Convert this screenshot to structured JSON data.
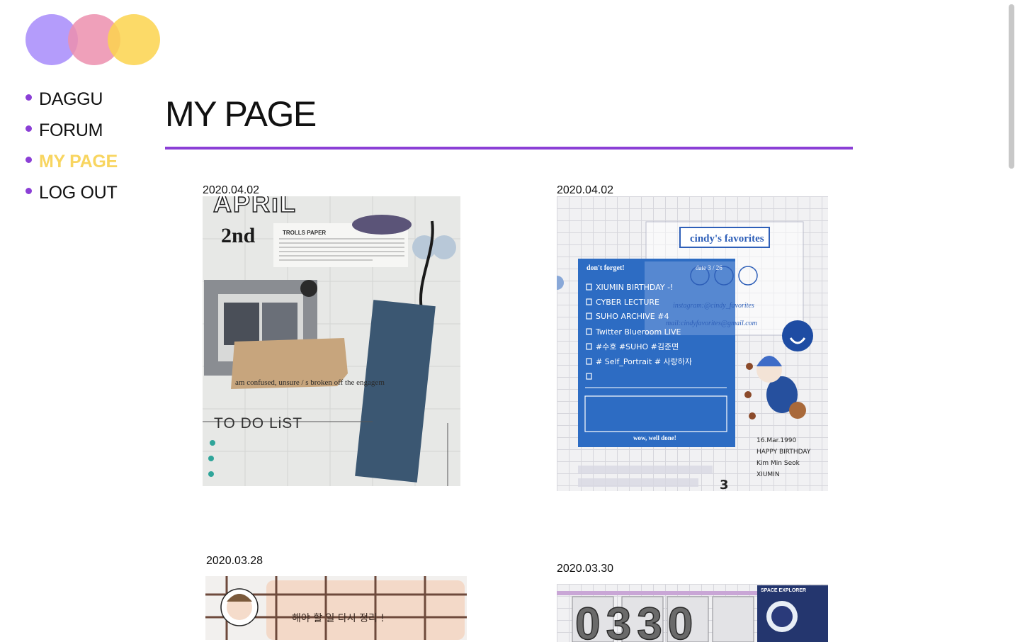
{
  "brand": {
    "logo_colors": [
      "#a78bfa",
      "#ec8fae",
      "#fcd34d"
    ]
  },
  "theme": {
    "accent": "#8b3fd6",
    "active_nav": "#f8d560",
    "rule": "#8b3fd6"
  },
  "nav": {
    "items": [
      {
        "label": "DAGGU"
      },
      {
        "label": "FORUM"
      },
      {
        "label": "MY PAGE"
      },
      {
        "label": "LOG OUT"
      }
    ]
  },
  "main": {
    "title": "MY PAGE",
    "posts": [
      {
        "date": "2020.04.02",
        "photo_text": {
          "month": "APRiL",
          "day": "2nd",
          "brand": "TROLLS PAPER",
          "todo": "TO DO LiST",
          "torn": "am confused, unsure / s broken off the engagem"
        }
      },
      {
        "date": "2020.04.02",
        "photo_text": {
          "banner": "cindy's favorites",
          "heading": "don't forget!",
          "date": "date 3 / 26",
          "tasks": [
            "XIUMIN BIRTHDAY -!",
            "CYBER LECTURE",
            "SUHO ARCHIVE #4",
            "Twitter Blueroom LIVE",
            "#수호 #SUHO #김준면",
            "# Self_Portrait # 사랑하자"
          ],
          "insta": "instagram:@cindy_favorites",
          "mail": "mail:cindyfavorites@gmail.com",
          "footer": "wow, well done!",
          "note": [
            "16.Mar.1990",
            "HAPPY BIRTHDAY",
            "Kim Min Seok",
            "XIUMIN"
          ],
          "number": "3"
        }
      },
      {
        "date": "2020.03.28",
        "photo_text": {
          "korean": "해야 할 일 다시 정리 !"
        }
      },
      {
        "date": "2020.03.30",
        "photo_text": {
          "digits": "0330",
          "badge": "SPACE EXPLORER"
        }
      }
    ]
  }
}
